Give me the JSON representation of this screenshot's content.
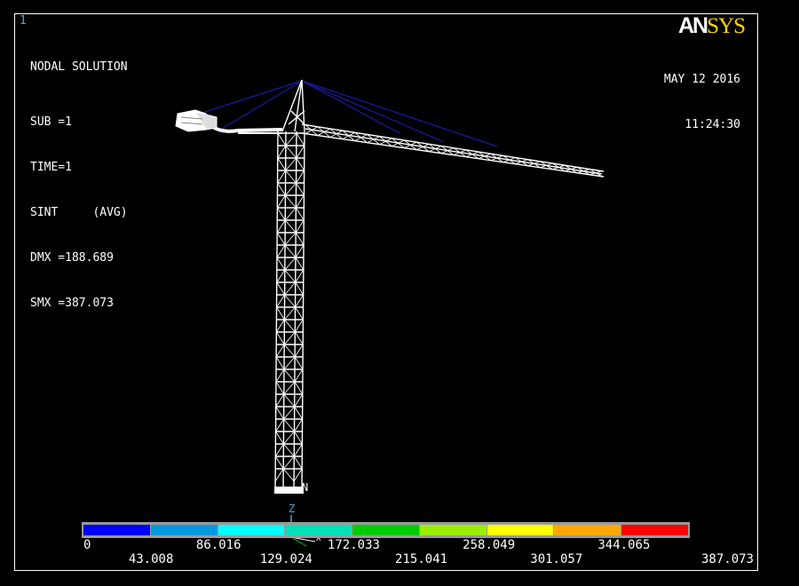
{
  "window": {
    "number": "1"
  },
  "brand": {
    "logo_part1": "AN",
    "logo_part2": "SYS",
    "logo_color": "#ffd400"
  },
  "timestamp": {
    "date": "MAY 12 2016",
    "time": "11:24:30"
  },
  "solution_info": {
    "title": "NODAL SOLUTION",
    "lines": [
      "SUB =1",
      "TIME=1",
      "SINT     (AVG)",
      "DMX =188.689",
      "SMX =387.073"
    ]
  },
  "triad": {
    "z_label": "Z",
    "x_label": "X",
    "n_label": "N",
    "z_color": "#4fa3d9"
  },
  "model": {
    "structure": "tower-crane",
    "mesh_color": "#ffffff",
    "cable_color": "#1a1aa6"
  },
  "legend": {
    "colors": [
      "#0000ff",
      "#0099dd",
      "#00ffff",
      "#00e0b8",
      "#00cc00",
      "#99ee00",
      "#ffff00",
      "#ffa600",
      "#ff0000"
    ],
    "labels_row1": [
      "0",
      "86.016",
      "172.033",
      "258.049",
      "344.065"
    ],
    "labels_row2": [
      "43.008",
      "129.024",
      "215.041",
      "301.057",
      "387.073"
    ]
  }
}
